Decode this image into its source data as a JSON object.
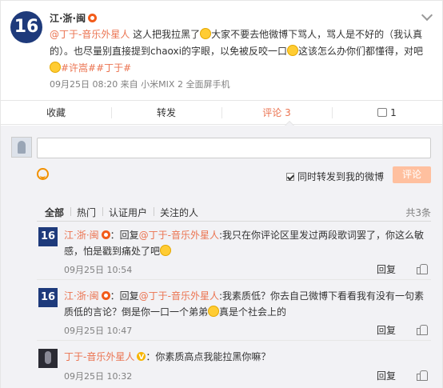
{
  "post": {
    "author": "江·浙·闽",
    "avatar_text": "16",
    "mention": "@丁于-音乐外星人",
    "text_1": " 这人把我拉黑了",
    "text_2": "大家不要去他微博下骂人，骂人是不好的（我认真的）。也尽量别直接提到chaoxi的字眼，以免被反咬一口",
    "text_3": "这该怎么办你们都懂得，对吧",
    "hashtags": "#许嵩##丁于#",
    "meta": "09月25日 08:20 来自 小米MIX 2 全面屏手机"
  },
  "actions": {
    "collect": "收藏",
    "forward": "转发",
    "comment": "评论 3",
    "like_count": "1"
  },
  "composer": {
    "forward_label": "同时转发到我的微博",
    "submit_label": "评论"
  },
  "tabs": {
    "all": "全部",
    "hot": "热门",
    "verified": "认证用户",
    "following": "关注的人",
    "count": "共3条"
  },
  "comments": [
    {
      "author": "江·浙·闽",
      "avatar_text": "16",
      "prefix": "：回复",
      "mention": "@丁于-音乐外星人",
      "text": ":我只在你评论区里发过两段歌词罢了，你这么敏感，怕是戳到痛处了吧",
      "time": "09月25日 10:54",
      "reply": "回复"
    },
    {
      "author": "江·浙·闽",
      "avatar_text": "16",
      "prefix": "：回复",
      "mention": "@丁于-音乐外星人",
      "text_1": ":我素质低？你去自己微博下看看我有没有一句素质低的言论？倒是你一口一个弟弟",
      "text_2": "真是个社会上的",
      "time": "09月25日 10:47",
      "reply": "回复"
    },
    {
      "author": "丁于-音乐外星人",
      "text": "：你素质高点我能拉黑你嘛？",
      "time": "09月25日 10:32",
      "reply": "回复"
    }
  ],
  "colors": {
    "accent": "#eb7350",
    "submit_bg": "#ffc09f",
    "avatar_blue": "#1e3a7b"
  }
}
